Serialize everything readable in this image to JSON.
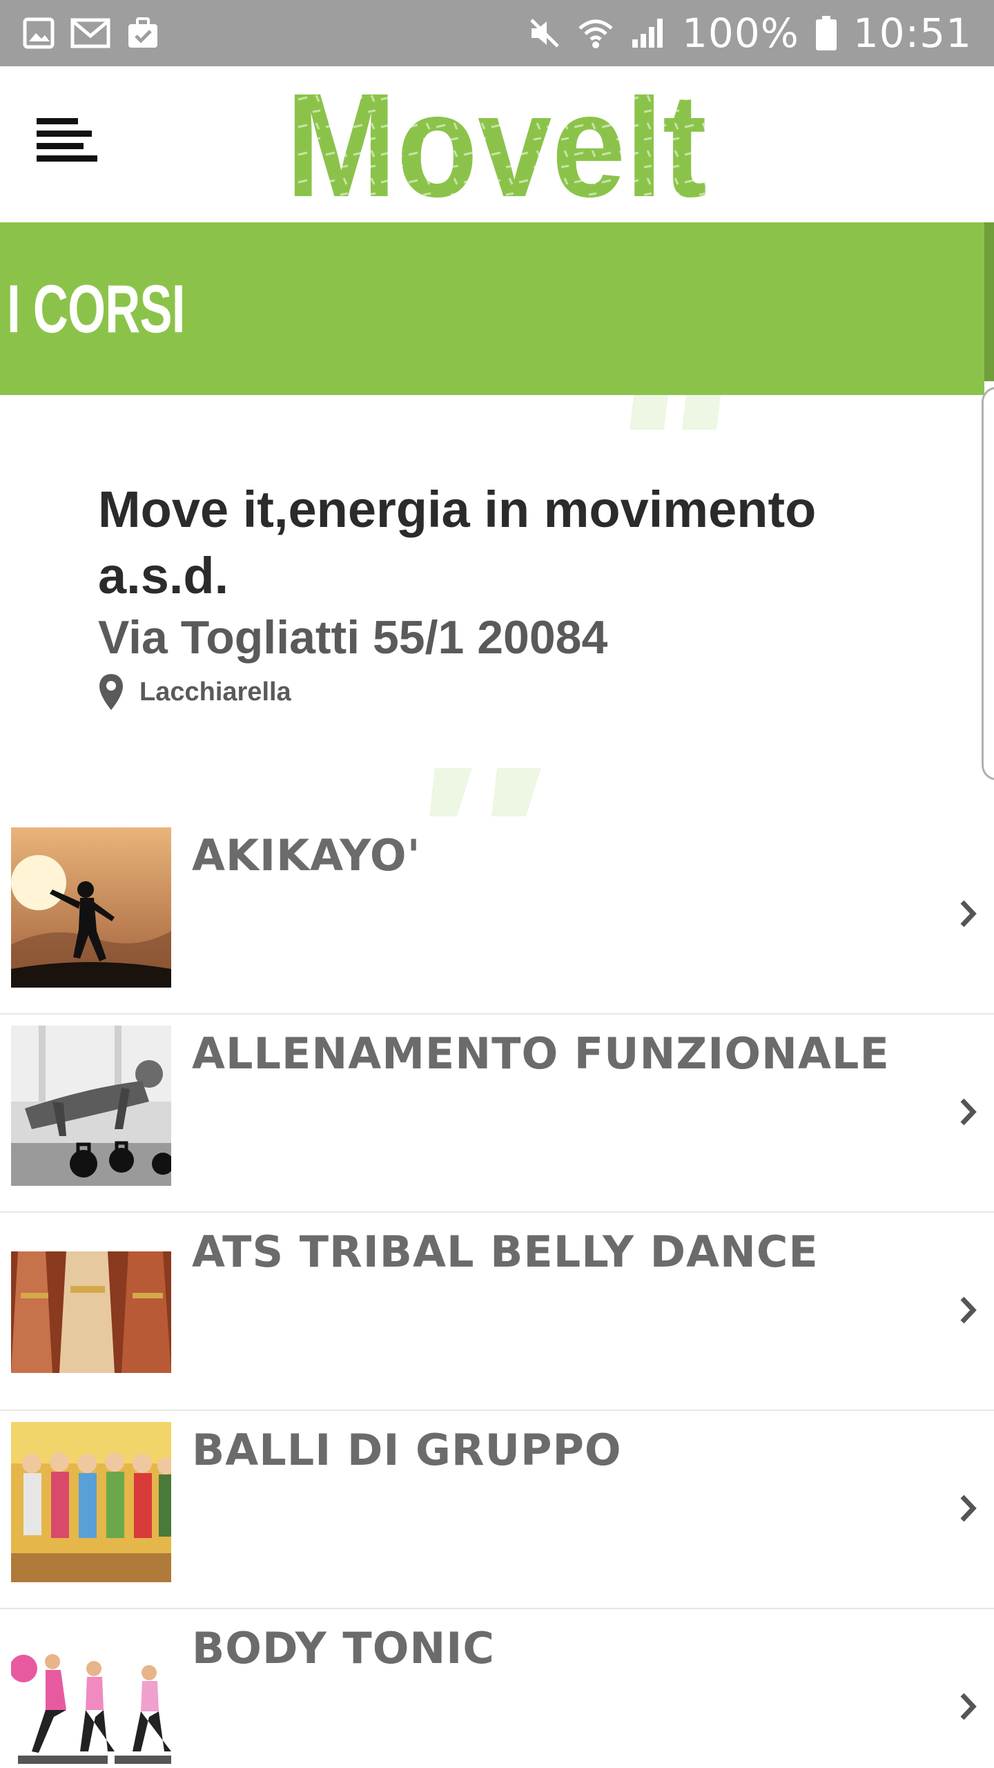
{
  "status_bar": {
    "battery": "100%",
    "time": "10:51",
    "left_icons": [
      "gallery-icon",
      "gmail-icon",
      "briefcase-icon"
    ],
    "right_icons": [
      "mute-icon",
      "wifi-icon",
      "signal-icon",
      "battery-icon"
    ]
  },
  "header": {
    "menu_icon": "menu-icon",
    "logo_text": "MoveIt",
    "brand_color": "#8bc34a"
  },
  "section": {
    "title": "I CORSI",
    "color": "#8bc34a"
  },
  "info": {
    "name": "Move it,energia in movimento a.s.d.",
    "address": "Via Togliatti 55/1 20084",
    "city": "Lacchiarella",
    "city_icon": "map-pin-icon"
  },
  "courses": [
    {
      "name": "AKIKAYO'",
      "thumb": "martial-arts-silhouette"
    },
    {
      "name": "ALLENAMENTO FUNZIONALE",
      "thumb": "pushups-kettlebells"
    },
    {
      "name": "ATS TRIBAL BELLY DANCE",
      "thumb": "belly-dancers"
    },
    {
      "name": "BALLI DI GRUPPO",
      "thumb": "group-dance-painting"
    },
    {
      "name": "BODY TONIC",
      "thumb": "step-aerobics-women"
    }
  ],
  "colors": {
    "status_bar": "#9e9e9e",
    "text_dark": "#2b2b2b",
    "text_muted": "#6b6b6b"
  }
}
